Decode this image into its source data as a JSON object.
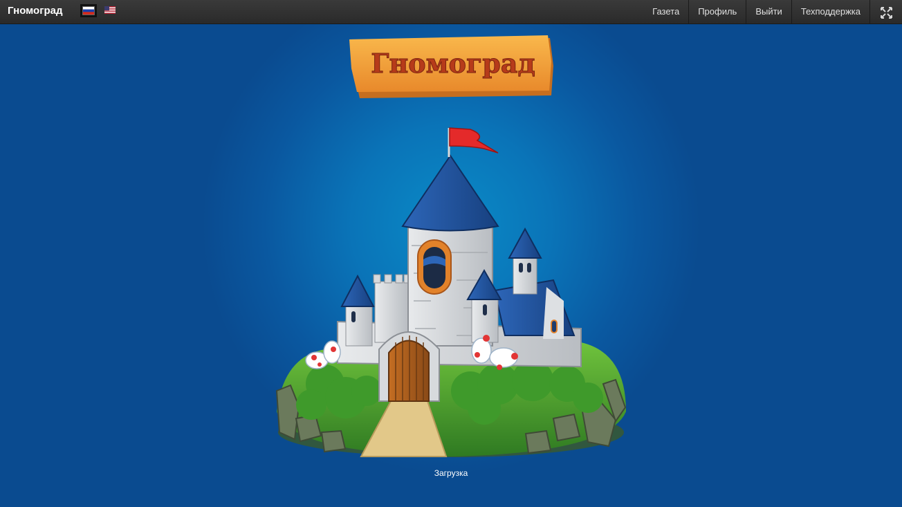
{
  "header": {
    "brand": "Гномоград",
    "nav": [
      "Газета",
      "Профиль",
      "Выйти",
      "Техподдержка"
    ]
  },
  "game": {
    "logo_text": "Гномоград",
    "loading_text": "Загрузка"
  },
  "icons": {
    "flag_ru": "russia-flag-icon",
    "flag_us": "usa-flag-icon",
    "fullscreen": "fullscreen-icon"
  },
  "colors": {
    "topbar": "#2f2f2f",
    "background": "#0a74b8",
    "logo_board": "#f4a53a",
    "logo_text": "#b63b1a",
    "roof": "#1f4f9c",
    "flag": "#e42a2a"
  }
}
